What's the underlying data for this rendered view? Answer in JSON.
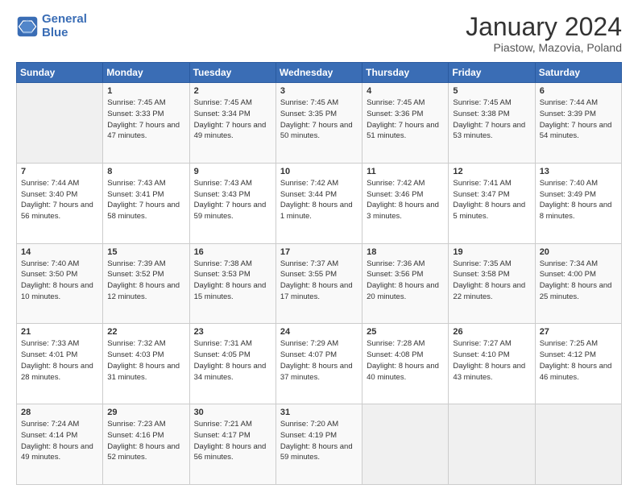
{
  "header": {
    "logo_general": "General",
    "logo_blue": "Blue",
    "title": "January 2024",
    "subtitle": "Piastow, Mazovia, Poland"
  },
  "weekdays": [
    "Sunday",
    "Monday",
    "Tuesday",
    "Wednesday",
    "Thursday",
    "Friday",
    "Saturday"
  ],
  "weeks": [
    [
      {
        "day": "",
        "sunrise": "",
        "sunset": "",
        "daylight": ""
      },
      {
        "day": "1",
        "sunrise": "Sunrise: 7:45 AM",
        "sunset": "Sunset: 3:33 PM",
        "daylight": "Daylight: 7 hours and 47 minutes."
      },
      {
        "day": "2",
        "sunrise": "Sunrise: 7:45 AM",
        "sunset": "Sunset: 3:34 PM",
        "daylight": "Daylight: 7 hours and 49 minutes."
      },
      {
        "day": "3",
        "sunrise": "Sunrise: 7:45 AM",
        "sunset": "Sunset: 3:35 PM",
        "daylight": "Daylight: 7 hours and 50 minutes."
      },
      {
        "day": "4",
        "sunrise": "Sunrise: 7:45 AM",
        "sunset": "Sunset: 3:36 PM",
        "daylight": "Daylight: 7 hours and 51 minutes."
      },
      {
        "day": "5",
        "sunrise": "Sunrise: 7:45 AM",
        "sunset": "Sunset: 3:38 PM",
        "daylight": "Daylight: 7 hours and 53 minutes."
      },
      {
        "day": "6",
        "sunrise": "Sunrise: 7:44 AM",
        "sunset": "Sunset: 3:39 PM",
        "daylight": "Daylight: 7 hours and 54 minutes."
      }
    ],
    [
      {
        "day": "7",
        "sunrise": "Sunrise: 7:44 AM",
        "sunset": "Sunset: 3:40 PM",
        "daylight": "Daylight: 7 hours and 56 minutes."
      },
      {
        "day": "8",
        "sunrise": "Sunrise: 7:43 AM",
        "sunset": "Sunset: 3:41 PM",
        "daylight": "Daylight: 7 hours and 58 minutes."
      },
      {
        "day": "9",
        "sunrise": "Sunrise: 7:43 AM",
        "sunset": "Sunset: 3:43 PM",
        "daylight": "Daylight: 7 hours and 59 minutes."
      },
      {
        "day": "10",
        "sunrise": "Sunrise: 7:42 AM",
        "sunset": "Sunset: 3:44 PM",
        "daylight": "Daylight: 8 hours and 1 minute."
      },
      {
        "day": "11",
        "sunrise": "Sunrise: 7:42 AM",
        "sunset": "Sunset: 3:46 PM",
        "daylight": "Daylight: 8 hours and 3 minutes."
      },
      {
        "day": "12",
        "sunrise": "Sunrise: 7:41 AM",
        "sunset": "Sunset: 3:47 PM",
        "daylight": "Daylight: 8 hours and 5 minutes."
      },
      {
        "day": "13",
        "sunrise": "Sunrise: 7:40 AM",
        "sunset": "Sunset: 3:49 PM",
        "daylight": "Daylight: 8 hours and 8 minutes."
      }
    ],
    [
      {
        "day": "14",
        "sunrise": "Sunrise: 7:40 AM",
        "sunset": "Sunset: 3:50 PM",
        "daylight": "Daylight: 8 hours and 10 minutes."
      },
      {
        "day": "15",
        "sunrise": "Sunrise: 7:39 AM",
        "sunset": "Sunset: 3:52 PM",
        "daylight": "Daylight: 8 hours and 12 minutes."
      },
      {
        "day": "16",
        "sunrise": "Sunrise: 7:38 AM",
        "sunset": "Sunset: 3:53 PM",
        "daylight": "Daylight: 8 hours and 15 minutes."
      },
      {
        "day": "17",
        "sunrise": "Sunrise: 7:37 AM",
        "sunset": "Sunset: 3:55 PM",
        "daylight": "Daylight: 8 hours and 17 minutes."
      },
      {
        "day": "18",
        "sunrise": "Sunrise: 7:36 AM",
        "sunset": "Sunset: 3:56 PM",
        "daylight": "Daylight: 8 hours and 20 minutes."
      },
      {
        "day": "19",
        "sunrise": "Sunrise: 7:35 AM",
        "sunset": "Sunset: 3:58 PM",
        "daylight": "Daylight: 8 hours and 22 minutes."
      },
      {
        "day": "20",
        "sunrise": "Sunrise: 7:34 AM",
        "sunset": "Sunset: 4:00 PM",
        "daylight": "Daylight: 8 hours and 25 minutes."
      }
    ],
    [
      {
        "day": "21",
        "sunrise": "Sunrise: 7:33 AM",
        "sunset": "Sunset: 4:01 PM",
        "daylight": "Daylight: 8 hours and 28 minutes."
      },
      {
        "day": "22",
        "sunrise": "Sunrise: 7:32 AM",
        "sunset": "Sunset: 4:03 PM",
        "daylight": "Daylight: 8 hours and 31 minutes."
      },
      {
        "day": "23",
        "sunrise": "Sunrise: 7:31 AM",
        "sunset": "Sunset: 4:05 PM",
        "daylight": "Daylight: 8 hours and 34 minutes."
      },
      {
        "day": "24",
        "sunrise": "Sunrise: 7:29 AM",
        "sunset": "Sunset: 4:07 PM",
        "daylight": "Daylight: 8 hours and 37 minutes."
      },
      {
        "day": "25",
        "sunrise": "Sunrise: 7:28 AM",
        "sunset": "Sunset: 4:08 PM",
        "daylight": "Daylight: 8 hours and 40 minutes."
      },
      {
        "day": "26",
        "sunrise": "Sunrise: 7:27 AM",
        "sunset": "Sunset: 4:10 PM",
        "daylight": "Daylight: 8 hours and 43 minutes."
      },
      {
        "day": "27",
        "sunrise": "Sunrise: 7:25 AM",
        "sunset": "Sunset: 4:12 PM",
        "daylight": "Daylight: 8 hours and 46 minutes."
      }
    ],
    [
      {
        "day": "28",
        "sunrise": "Sunrise: 7:24 AM",
        "sunset": "Sunset: 4:14 PM",
        "daylight": "Daylight: 8 hours and 49 minutes."
      },
      {
        "day": "29",
        "sunrise": "Sunrise: 7:23 AM",
        "sunset": "Sunset: 4:16 PM",
        "daylight": "Daylight: 8 hours and 52 minutes."
      },
      {
        "day": "30",
        "sunrise": "Sunrise: 7:21 AM",
        "sunset": "Sunset: 4:17 PM",
        "daylight": "Daylight: 8 hours and 56 minutes."
      },
      {
        "day": "31",
        "sunrise": "Sunrise: 7:20 AM",
        "sunset": "Sunset: 4:19 PM",
        "daylight": "Daylight: 8 hours and 59 minutes."
      },
      {
        "day": "",
        "sunrise": "",
        "sunset": "",
        "daylight": ""
      },
      {
        "day": "",
        "sunrise": "",
        "sunset": "",
        "daylight": ""
      },
      {
        "day": "",
        "sunrise": "",
        "sunset": "",
        "daylight": ""
      }
    ]
  ]
}
